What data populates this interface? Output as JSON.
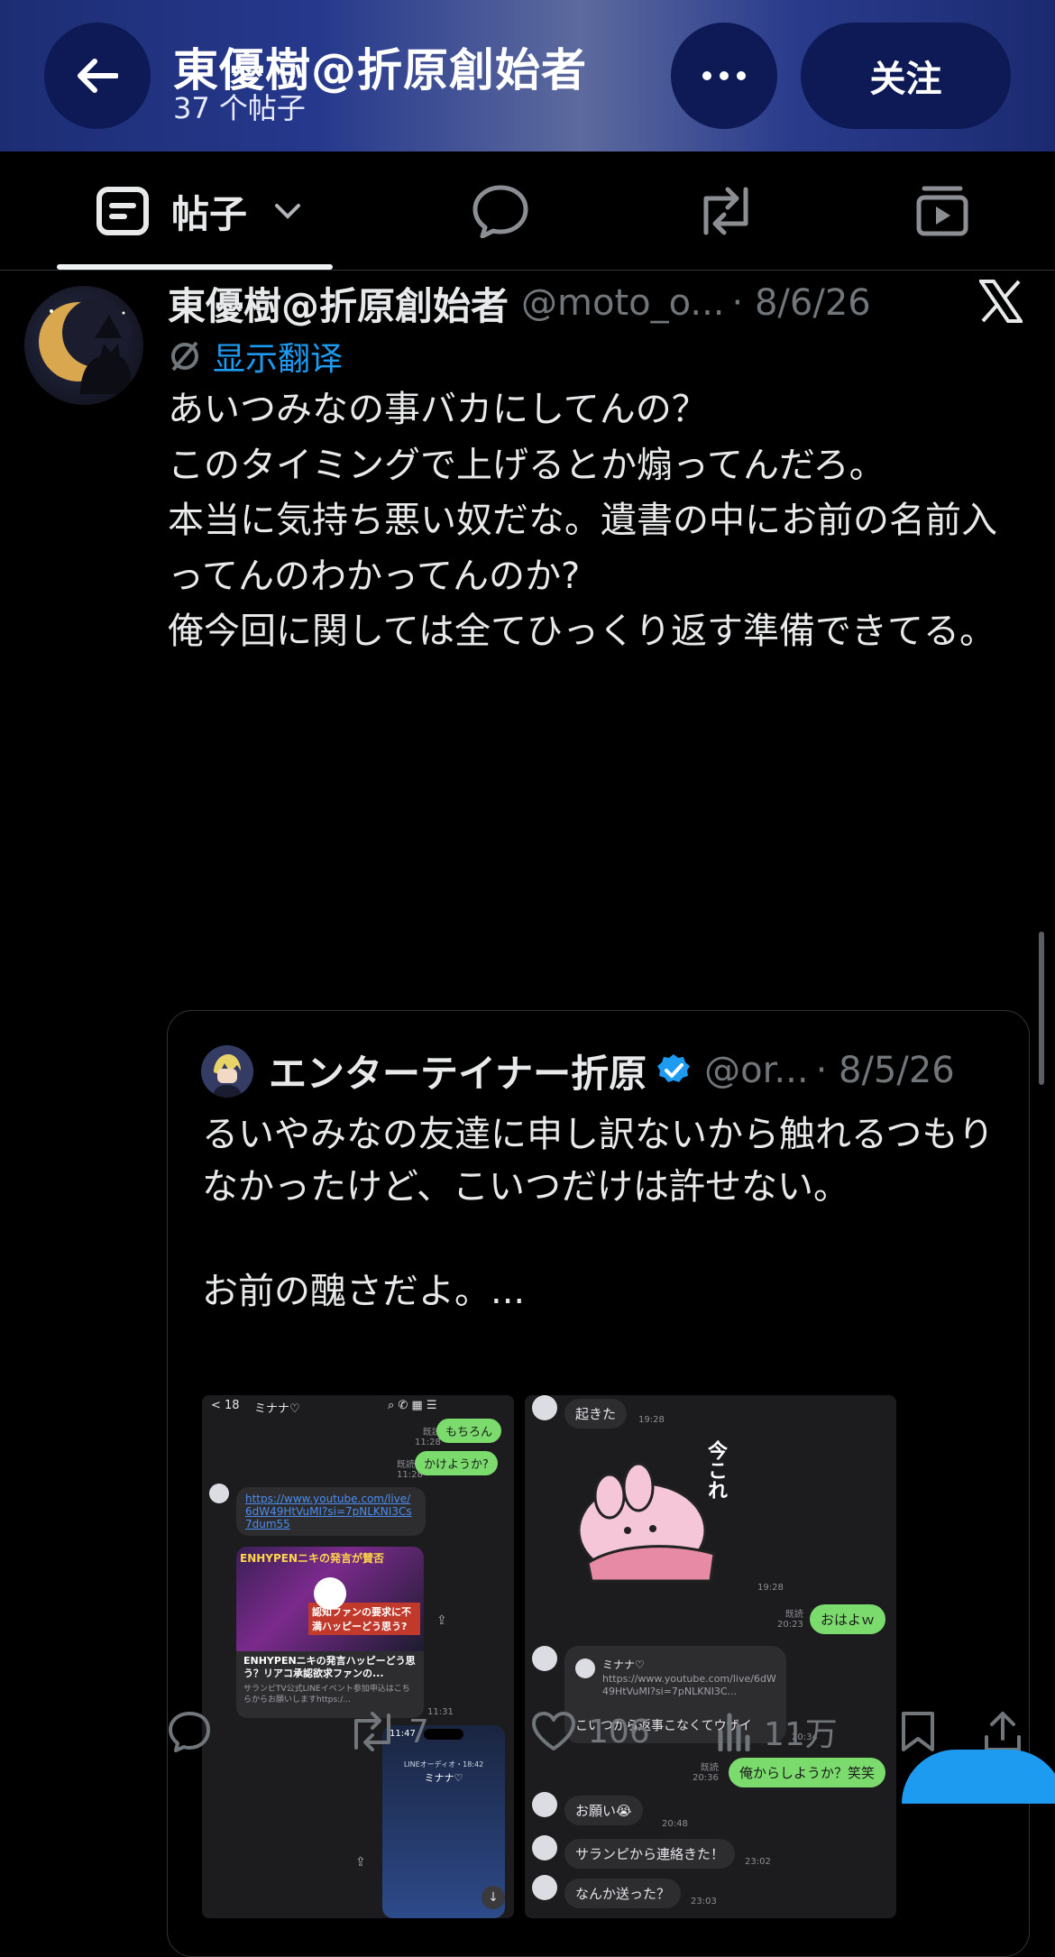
{
  "header": {
    "title": "東優樹@折原創始者",
    "post_count": "37 个帖子",
    "follow_label": "关注"
  },
  "tabs": [
    {
      "label": "帖子",
      "icon": "posts-icon",
      "active": true
    },
    {
      "icon": "reply-icon"
    },
    {
      "icon": "repost-icon"
    },
    {
      "icon": "media-icon"
    }
  ],
  "post": {
    "author": "東優樹@折原創始者",
    "handle": "@moto_o...",
    "date": "· 8/6/26",
    "translate_label": "显示翻译",
    "text": "あいつみなの事バカにしてんの？\nこのタイミングで上げるとか煽ってんだろ。\n本当に気持ち悪い奴だな。遺書の中にお前の名前入ってんのわかってんのか?\n俺今回に関しては全てひっくり返す準備できてる。"
  },
  "quote": {
    "author": "エンターテイナー折原",
    "handle": "@or...",
    "date": "· 8/5/26",
    "verified": true,
    "text": "るいやみなの友達に申し訳ないから触れるつもりなかったけど、こいつだけは許せない。\n\nお前の醜さだよ。..."
  },
  "screenshot_left": {
    "back_count": "< 18",
    "contact": "ミナナ♡",
    "msg1": "もちろん",
    "msg1_time": "既読\n11:28",
    "msg2": "かけようか?",
    "msg2_time": "既読\n11:28",
    "link": "https://www.youtube.com/live/6dW49HtVuMI?si=7pNLKNI3Cs7dum55",
    "thumb_title": "ENHYPENニキの発言が賛否",
    "thumb_sub": "認知ファンの要求に不満ハッピーどう思う?",
    "card_title": "ENHYPENニキの発言ハッピーどう思う？リアコ承認欲求ファンの...",
    "card_desc": "サランピTV公式LINEイベント参加申込はこちらからお願いしますhttps:/...",
    "card_time": "11:31",
    "call_label": "LINEオーディオ・18:42",
    "call_name": "ミナナ♡",
    "phone_time": "11:47"
  },
  "screenshot_right": {
    "msg1": "起きた",
    "msg1_time": "19:28",
    "sticker_text": "今これ",
    "sticker_time": "19:28",
    "msg2": "おはよｗ",
    "msg2_time": "既読\n20:23",
    "fwd_name": "ミナナ♡",
    "fwd_link": "https://www.youtube.com/live/6dW49HtVuMI?si=7pNLKNI3C...",
    "fwd_text": "こいつから返事こなくてウザイ",
    "fwd_time": "20:34",
    "msg3": "俺からしようか？笑笑",
    "msg3_time": "既読\n20:36",
    "msg4": "お願い😭",
    "msg4_time": "20:48",
    "msg5": "サランピから連絡きた！",
    "msg5_time": "23:02",
    "msg6": "なんか送った？",
    "msg6_time": "23:03"
  },
  "actions": {
    "reply_count": "",
    "repost_count": "7",
    "like_count": "106",
    "views_count": "11万"
  },
  "colors": {
    "accent": "#1d9bf0",
    "line_green": "#7bdc6d",
    "muted": "#71767b"
  }
}
